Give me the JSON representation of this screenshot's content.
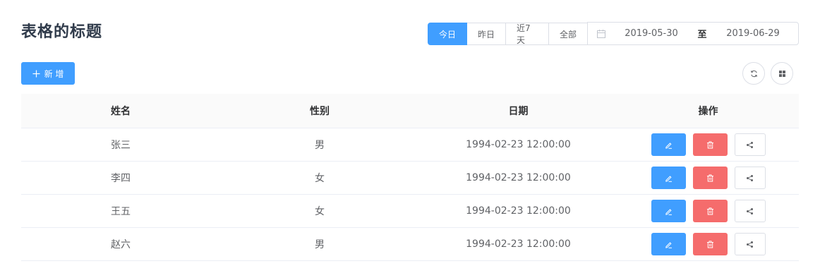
{
  "page": {
    "title": "表格的标题"
  },
  "range_buttons": [
    "今日",
    "昨日",
    "近7天",
    "全部"
  ],
  "date_range": {
    "start": "2019-05-30",
    "separator": "至",
    "end": "2019-06-29"
  },
  "toolbar": {
    "add_label": "新 增"
  },
  "table": {
    "headers": [
      "姓名",
      "性别",
      "日期",
      "操作"
    ],
    "rows": [
      {
        "name": "张三",
        "gender": "男",
        "date": "1994-02-23 12:00:00"
      },
      {
        "name": "李四",
        "gender": "女",
        "date": "1994-02-23 12:00:00"
      },
      {
        "name": "王五",
        "gender": "女",
        "date": "1994-02-23 12:00:00"
      },
      {
        "name": "赵六",
        "gender": "男",
        "date": "1994-02-23 12:00:00"
      }
    ]
  },
  "colors": {
    "primary": "#409eff",
    "danger": "#f56c6c",
    "title": "#303b4b"
  },
  "icons": [
    "calendar-icon",
    "plus-icon",
    "refresh-icon",
    "grid-icon",
    "edit-icon",
    "delete-icon",
    "share-icon"
  ]
}
